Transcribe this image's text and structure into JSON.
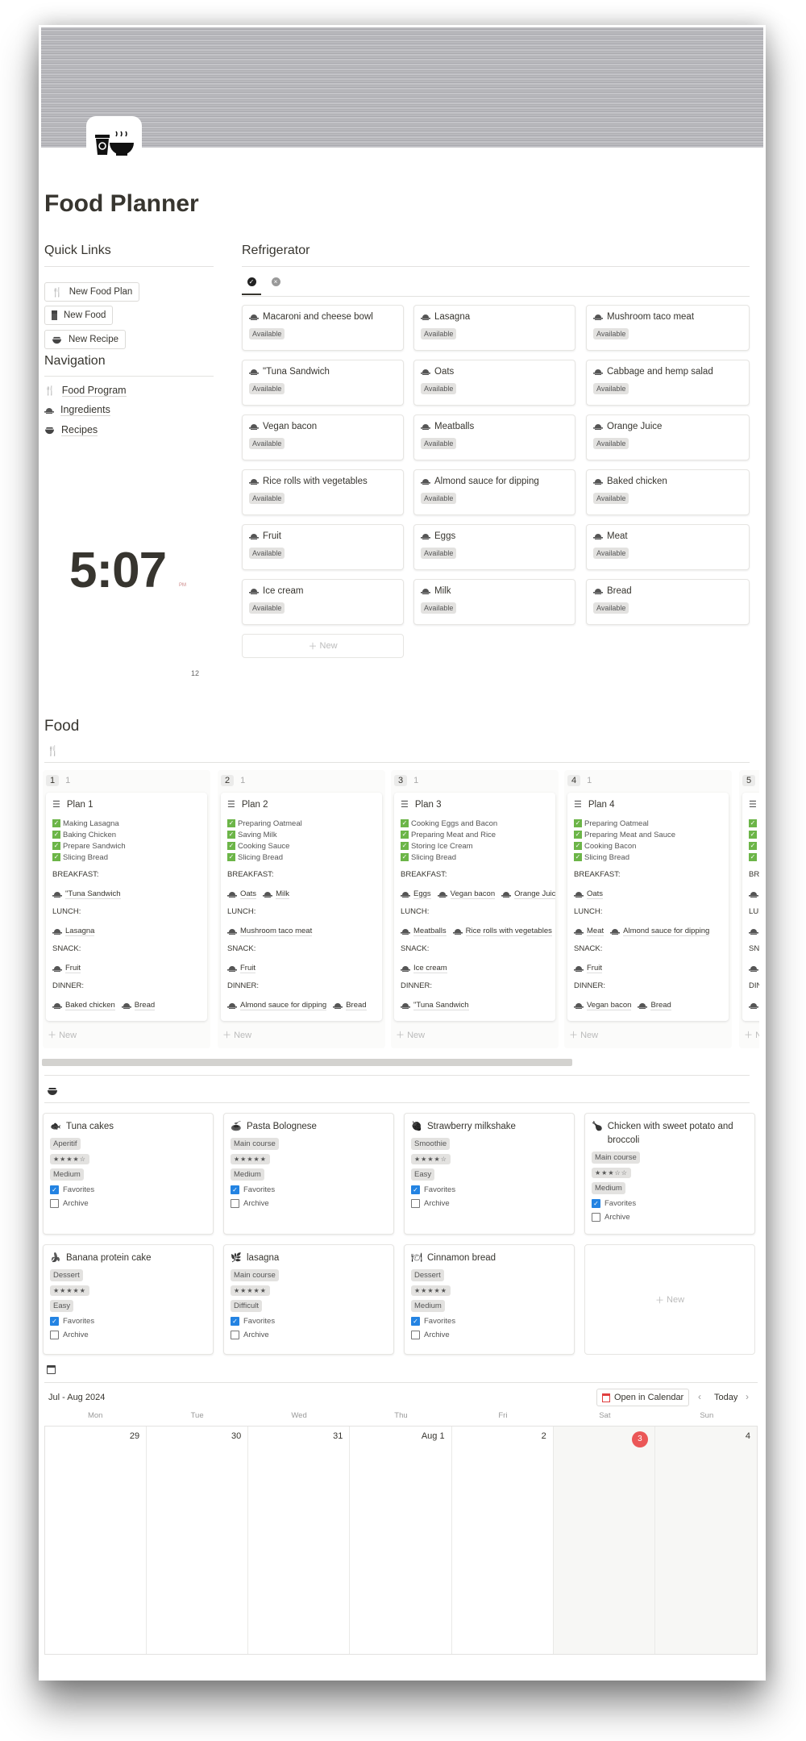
{
  "page": {
    "title": "Food Planner"
  },
  "quick_links": {
    "heading": "Quick Links",
    "buttons": [
      {
        "label": "New Food Plan",
        "icon": "fork-knife-icon"
      },
      {
        "label": "New Food",
        "icon": "fridge-icon"
      },
      {
        "label": "New Recipe",
        "icon": "bowl-icon"
      }
    ]
  },
  "navigation": {
    "heading": "Navigation",
    "items": [
      {
        "label": "Food Program",
        "icon": "fork-knife-icon"
      },
      {
        "label": "Ingredients",
        "icon": "dish-icon"
      },
      {
        "label": "Recipes",
        "icon": "bowl-icon"
      }
    ]
  },
  "clock": {
    "time": "5:07",
    "ampm": "PM",
    "extra": "12"
  },
  "refrigerator": {
    "heading": "Refrigerator",
    "tabs": [
      {
        "icon": "check-circle-icon",
        "active": true
      },
      {
        "icon": "x-circle-icon",
        "active": false
      }
    ],
    "items": [
      {
        "name": "Macaroni and cheese bowl",
        "status": "Available"
      },
      {
        "name": "Lasagna",
        "status": "Available"
      },
      {
        "name": "Mushroom taco meat",
        "status": "Available"
      },
      {
        "name": "\"Tuna Sandwich",
        "status": "Available"
      },
      {
        "name": "Oats",
        "status": "Available"
      },
      {
        "name": "Cabbage and hemp salad",
        "status": "Available"
      },
      {
        "name": "Vegan bacon",
        "status": "Available"
      },
      {
        "name": "Meatballs",
        "status": "Available"
      },
      {
        "name": "Orange Juice",
        "status": "Available"
      },
      {
        "name": "Rice rolls with vegetables",
        "status": "Available"
      },
      {
        "name": "Almond sauce for dipping",
        "status": "Available"
      },
      {
        "name": "Baked chicken",
        "status": "Available"
      },
      {
        "name": "Fruit",
        "status": "Available"
      },
      {
        "name": "Eggs",
        "status": "Available"
      },
      {
        "name": "Meat",
        "status": "Available"
      },
      {
        "name": "Ice cream",
        "status": "Available"
      },
      {
        "name": "Milk",
        "status": "Available"
      },
      {
        "name": "Bread",
        "status": "Available"
      }
    ],
    "new_label": "New"
  },
  "food": {
    "heading": "Food",
    "new_label": "New",
    "labels": {
      "breakfast": "BREAKFAST:",
      "lunch": "LUNCH:",
      "snack": "SNACK:",
      "dinner": "DINNER:"
    },
    "columns": [
      {
        "group": "1",
        "count": "1",
        "plan": "Plan 1",
        "tasks": [
          "Making Lasagna",
          "Baking Chicken",
          "Prepare Sandwich",
          "Slicing Bread"
        ],
        "breakfast": [
          "\"Tuna Sandwich"
        ],
        "lunch": [
          "Lasagna"
        ],
        "snack": [
          "Fruit"
        ],
        "dinner": [
          "Baked chicken",
          "Bread"
        ]
      },
      {
        "group": "2",
        "count": "1",
        "plan": "Plan 2",
        "tasks": [
          "Preparing Oatmeal",
          "Saving Milk",
          "Cooking Sauce",
          "Slicing Bread"
        ],
        "breakfast": [
          "Oats",
          "Milk"
        ],
        "lunch": [
          "Mushroom taco meat"
        ],
        "snack": [
          "Fruit"
        ],
        "dinner": [
          "Almond sauce for dipping",
          "Bread"
        ]
      },
      {
        "group": "3",
        "count": "1",
        "plan": "Plan 3",
        "tasks": [
          "Cooking Eggs and Bacon",
          "Preparing Meat and Rice",
          "Storing Ice Cream",
          "Slicing Bread"
        ],
        "breakfast": [
          "Eggs",
          "Vegan bacon",
          "Orange Juice"
        ],
        "lunch": [
          "Meatballs",
          "Rice rolls with vegetables"
        ],
        "snack": [
          "Ice cream"
        ],
        "dinner": [
          "\"Tuna Sandwich"
        ]
      },
      {
        "group": "4",
        "count": "1",
        "plan": "Plan 4",
        "tasks": [
          "Preparing Oatmeal",
          "Preparing Meat and Sauce",
          "Cooking Bacon",
          "Slicing Bread"
        ],
        "breakfast": [
          "Oats"
        ],
        "lunch": [
          "Meat",
          "Almond sauce for dipping"
        ],
        "snack": [
          "Fruit"
        ],
        "dinner": [
          "Vegan bacon",
          "Bread"
        ]
      },
      {
        "group": "5",
        "count": "",
        "plan": "",
        "tasks": [
          "",
          "",
          "",
          ""
        ],
        "breakfast": [
          ""
        ],
        "lunch": [
          ""
        ],
        "snack": [
          ""
        ],
        "dinner": [
          ""
        ]
      }
    ]
  },
  "recipes": {
    "new_label": "New",
    "favorites_label": "Favorites",
    "archive_label": "Archive",
    "items": [
      {
        "name": "Tuna cakes",
        "icon": "fish-icon",
        "category": "Aperitif",
        "rating": 4,
        "difficulty": "Medium",
        "favorite": true,
        "archive": false
      },
      {
        "name": "Pasta Bolognese",
        "icon": "pasta-icon",
        "category": "Main course",
        "rating": 5,
        "difficulty": "Medium",
        "favorite": true,
        "archive": false
      },
      {
        "name": "Strawberry milkshake",
        "icon": "strawberry-icon",
        "category": "Smoothie",
        "rating": 4,
        "difficulty": "Easy",
        "favorite": true,
        "archive": false
      },
      {
        "name": "Chicken with sweet potato and broccoli",
        "icon": "chicken-icon",
        "category": "Main course",
        "rating": 3,
        "difficulty": "Medium",
        "favorite": true,
        "archive": false
      },
      {
        "name": "Banana protein cake",
        "icon": "banana-icon",
        "category": "Dessert",
        "rating": 5,
        "difficulty": "Easy",
        "favorite": true,
        "archive": false
      },
      {
        "name": "lasagna",
        "icon": "herb-icon",
        "category": "Main course",
        "rating": 5,
        "difficulty": "Difficult",
        "favorite": true,
        "archive": false
      },
      {
        "name": "Cinnamon bread",
        "icon": "plate-icon",
        "category": "Dessert",
        "rating": 5,
        "difficulty": "Medium",
        "favorite": true,
        "archive": false
      }
    ]
  },
  "calendar": {
    "range": "Jul - Aug 2024",
    "open_label": "Open in Calendar",
    "today_label": "Today",
    "weekdays": [
      "Mon",
      "Tue",
      "Wed",
      "Thu",
      "Fri",
      "Sat",
      "Sun"
    ],
    "days": [
      "29",
      "30",
      "31",
      "Aug 1",
      "2",
      "3",
      "4"
    ],
    "today_index": 5,
    "today_color": "#eb5757"
  },
  "colors": {
    "accent": "#2383e2",
    "check_green": "#6cb548"
  }
}
